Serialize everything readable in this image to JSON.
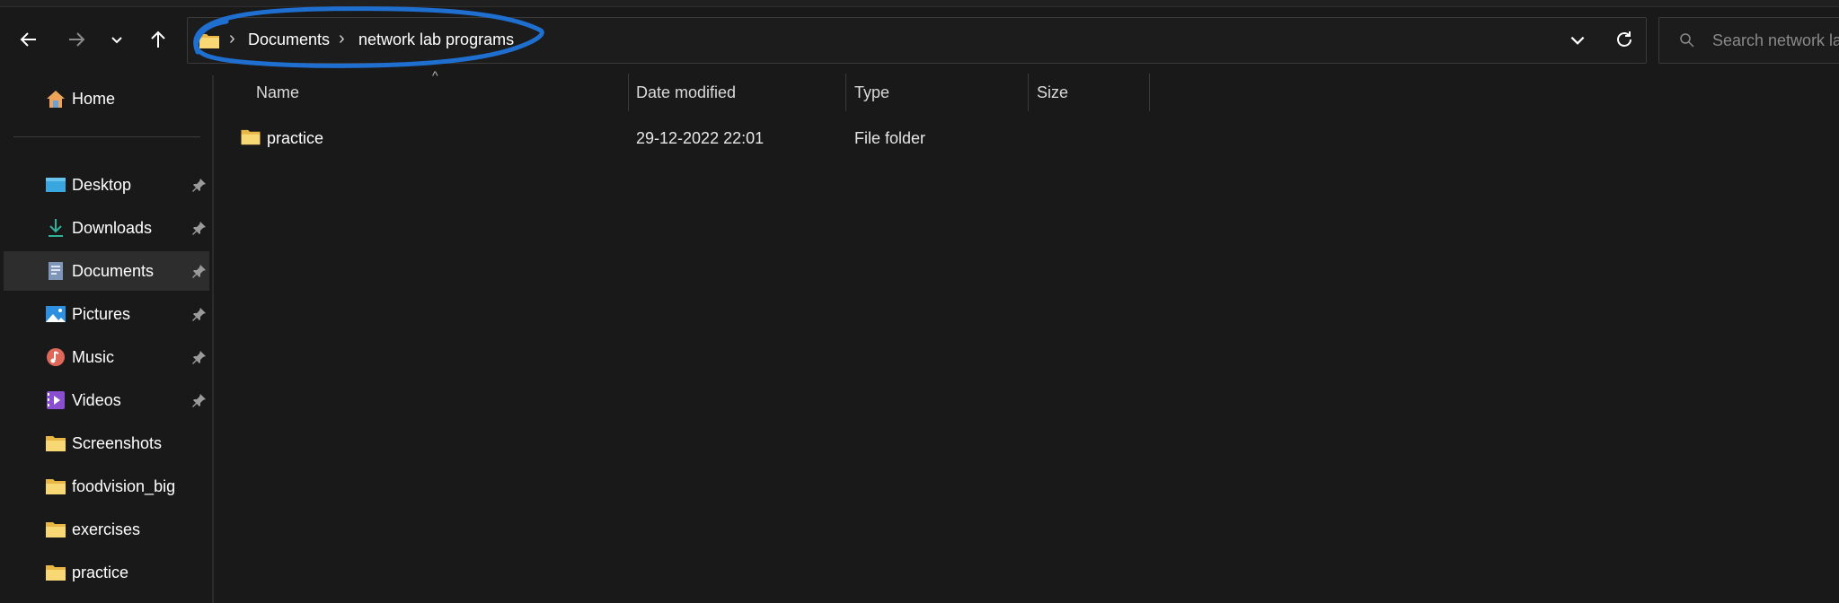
{
  "toolbar": {
    "back_icon": "arrow-left-icon",
    "forward_icon": "arrow-right-icon",
    "recent_icon": "chevron-down-icon",
    "up_icon": "arrow-up-icon"
  },
  "address_bar": {
    "crumbs": [
      "Documents",
      "network lab programs"
    ],
    "separator": "›",
    "annotation_color": "#1f6fd1"
  },
  "search": {
    "placeholder": "Search network lab programs"
  },
  "sidebar": {
    "home": "Home",
    "items": [
      {
        "label": "Desktop",
        "icon": "desktop-icon",
        "pinned": true
      },
      {
        "label": "Downloads",
        "icon": "downloads-icon",
        "pinned": true
      },
      {
        "label": "Documents",
        "icon": "documents-icon",
        "pinned": true,
        "active": true
      },
      {
        "label": "Pictures",
        "icon": "pictures-icon",
        "pinned": true
      },
      {
        "label": "Music",
        "icon": "music-icon",
        "pinned": true
      },
      {
        "label": "Videos",
        "icon": "videos-icon",
        "pinned": true
      },
      {
        "label": "Screenshots",
        "icon": "folder-icon",
        "pinned": false
      },
      {
        "label": "foodvision_big",
        "icon": "folder-icon",
        "pinned": false
      },
      {
        "label": "exercises",
        "icon": "folder-icon",
        "pinned": false
      },
      {
        "label": "practice",
        "icon": "folder-icon",
        "pinned": false
      }
    ]
  },
  "columns": {
    "name": "Name",
    "date": "Date modified",
    "type": "Type",
    "size": "Size",
    "sort_indicator": "^"
  },
  "files": [
    {
      "name": "practice",
      "date": "29-12-2022 22:01",
      "type": "File folder",
      "size": ""
    }
  ]
}
